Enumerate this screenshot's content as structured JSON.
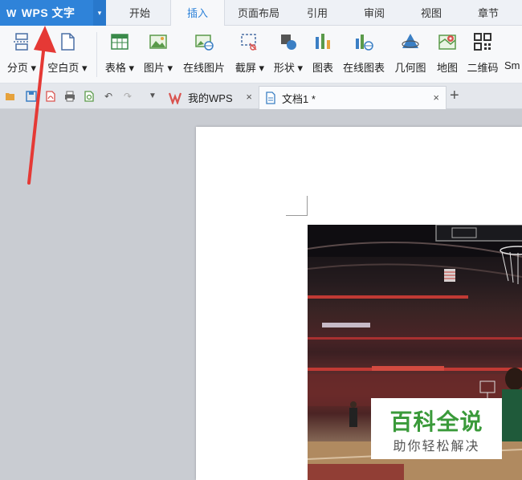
{
  "app": {
    "logo": "W",
    "title": "WPS 文字",
    "dropdown": "▾"
  },
  "menu": {
    "tabs": [
      {
        "label": "开始"
      },
      {
        "label": "插入"
      },
      {
        "label": "页面布局"
      },
      {
        "label": "引用"
      },
      {
        "label": "审阅"
      },
      {
        "label": "视图"
      },
      {
        "label": "章节"
      }
    ],
    "active_tab": "插入"
  },
  "ribbon": {
    "items": [
      {
        "label": "分页 ▾",
        "icon": "page-break-icon"
      },
      {
        "label": "空白页 ▾",
        "icon": "blank-page-icon"
      },
      {
        "label": "表格 ▾",
        "icon": "table-icon"
      },
      {
        "label": "图片 ▾",
        "icon": "picture-icon"
      },
      {
        "label": "在线图片",
        "icon": "online-picture-icon"
      },
      {
        "label": "截屏 ▾",
        "icon": "screenshot-icon"
      },
      {
        "label": "形状 ▾",
        "icon": "shapes-icon"
      },
      {
        "label": "图表",
        "icon": "chart-icon"
      },
      {
        "label": "在线图表",
        "icon": "online-chart-icon"
      },
      {
        "label": "几何图",
        "icon": "geometry-icon"
      },
      {
        "label": "地图",
        "icon": "map-icon"
      },
      {
        "label": "二维码",
        "icon": "qrcode-icon"
      },
      {
        "label": "Sm",
        "icon": "smartart-icon"
      }
    ]
  },
  "docbar": {
    "tabs": [
      {
        "label": "我的WPS",
        "close": "×"
      },
      {
        "label": "文档1 *",
        "close": "×"
      }
    ],
    "new_tab": "+"
  },
  "watermark": {
    "title": "百科全说",
    "subtitle": "助你轻松解决"
  },
  "colors": {
    "brand": "#2f83d9",
    "accent_green": "#3a9a3a",
    "annotation": "#e53935"
  }
}
